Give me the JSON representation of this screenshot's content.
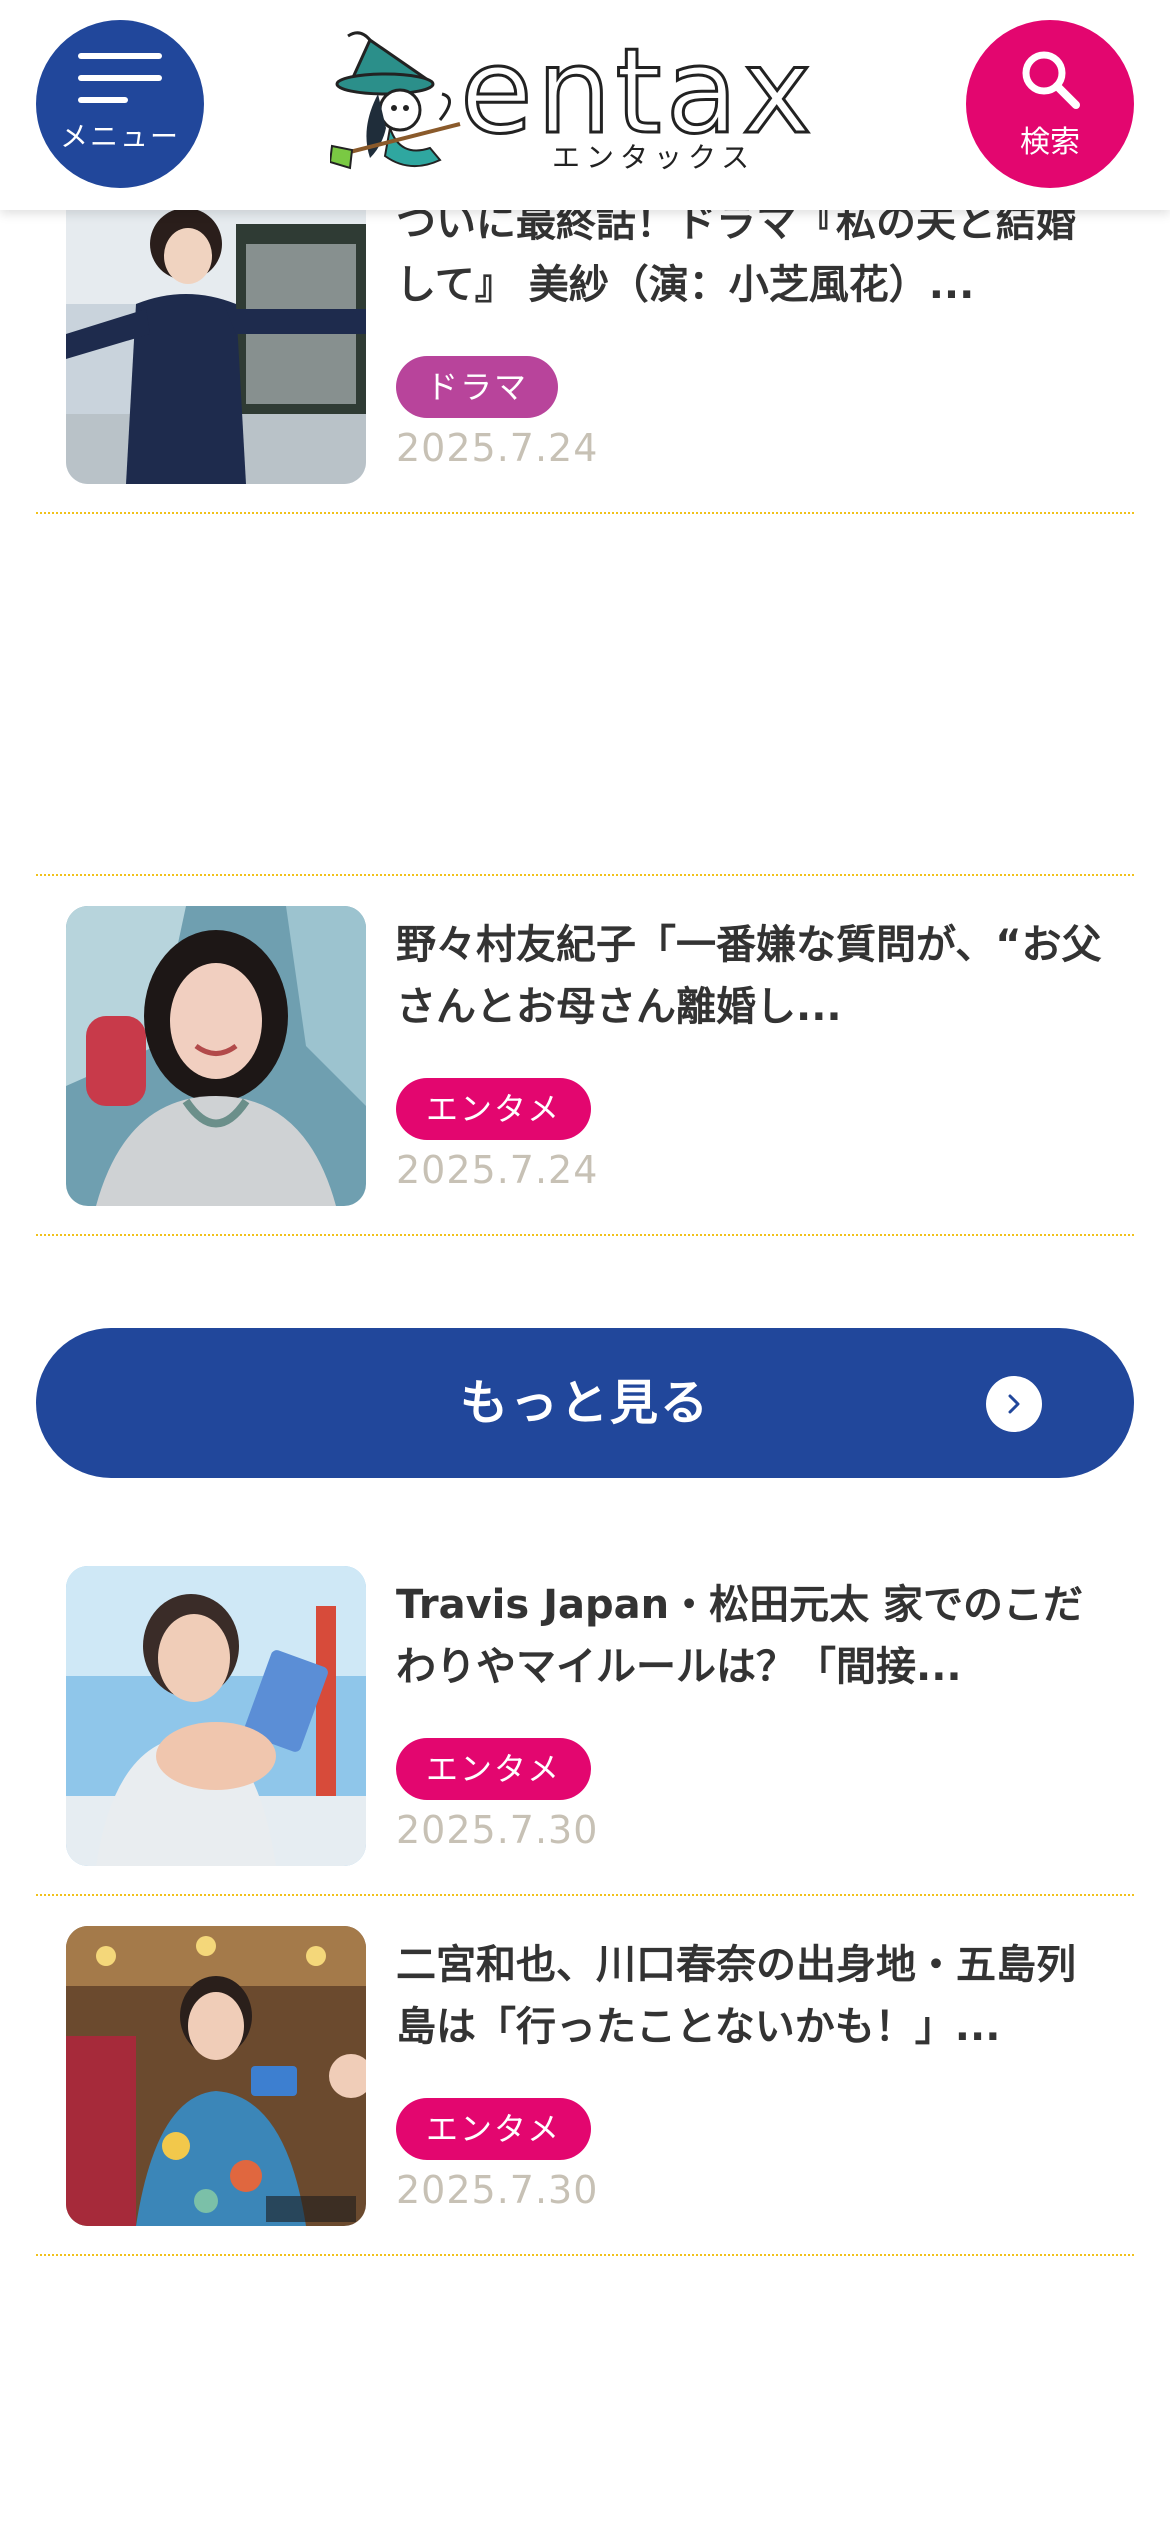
{
  "header": {
    "menu_label": "メニュー",
    "logo_text": "entax",
    "logo_kana": "エンタックス",
    "search_label": "検索"
  },
  "articles_top": [
    {
      "title": "ついに最終話！ドラマ『私の夫と結婚して』 美紗（演：小芝風花）...",
      "tag": "ドラマ",
      "tag_color": "#b8449b",
      "date": "2025.7.24"
    },
    {
      "title": "野々村友紀子「一番嫌な質問が、“お父さんとお母さん離婚し...",
      "tag": "エンタメ",
      "tag_color": "#e3066f",
      "date": "2025.7.24"
    }
  ],
  "more_button": {
    "label": "もっと見る"
  },
  "articles_bottom": [
    {
      "title": "Travis Japan・松田元太 家でのこだわりやマイルールは？「間接...",
      "tag": "エンタメ",
      "tag_color": "#e3066f",
      "date": "2025.7.30"
    },
    {
      "title": "二宮和也、川口春奈の出身地・五島列島は「行ったことないかも！」...",
      "tag": "エンタメ",
      "tag_color": "#e3066f",
      "date": "2025.7.30"
    }
  ],
  "colors": {
    "brand_blue": "#21479b",
    "brand_pink": "#e3066f",
    "divider": "#f1c21b",
    "date_gray": "#c7c1b5"
  }
}
